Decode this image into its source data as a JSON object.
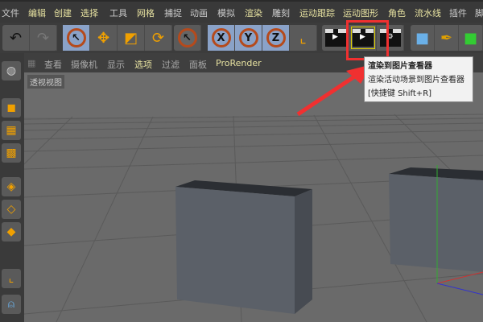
{
  "menu": [
    "文件",
    "编辑",
    "创建",
    "选择",
    "工具",
    "网格",
    "捕捉",
    "动画",
    "模拟",
    "渲染",
    "雕刻",
    "运动跟踪",
    "运动图形",
    "角色",
    "流水线",
    "插件",
    "脚"
  ],
  "toolbar": {
    "x": "X",
    "y": "Y",
    "z": "Z"
  },
  "viewport_menu": [
    "查看",
    "摄像机",
    "显示",
    "选项",
    "过滤",
    "面板",
    "ProRender"
  ],
  "viewport_label": "透视视图",
  "tooltip": {
    "title": "渲染到图片查看器",
    "description": "渲染活动场景到图片查看器",
    "shortcut": "[快捷键 Shift+R]"
  },
  "colors": {
    "highlight": "#f03030",
    "accent": "#f0a000"
  }
}
